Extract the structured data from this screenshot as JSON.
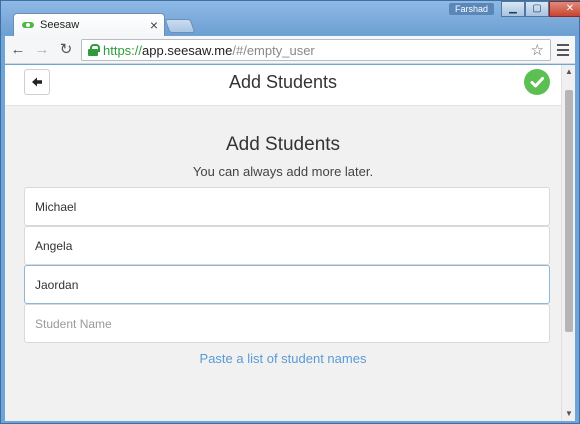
{
  "browser": {
    "tab_title": "Seesaw",
    "user_name": "Farshad",
    "url_scheme": "https://",
    "url_host": "app.seesaw.me",
    "url_path": "/#/empty_user"
  },
  "header": {
    "title": "Add Students"
  },
  "main": {
    "title": "Add Students",
    "subtitle": "You can always add more later.",
    "students": [
      "Michael",
      "Angela",
      "Jaordan"
    ],
    "new_student_placeholder": "Student Name",
    "paste_link": "Paste a list of student names"
  },
  "colors": {
    "accent": "#5cbf52",
    "link": "#5a9bd5",
    "secure": "#2f9b3a"
  }
}
